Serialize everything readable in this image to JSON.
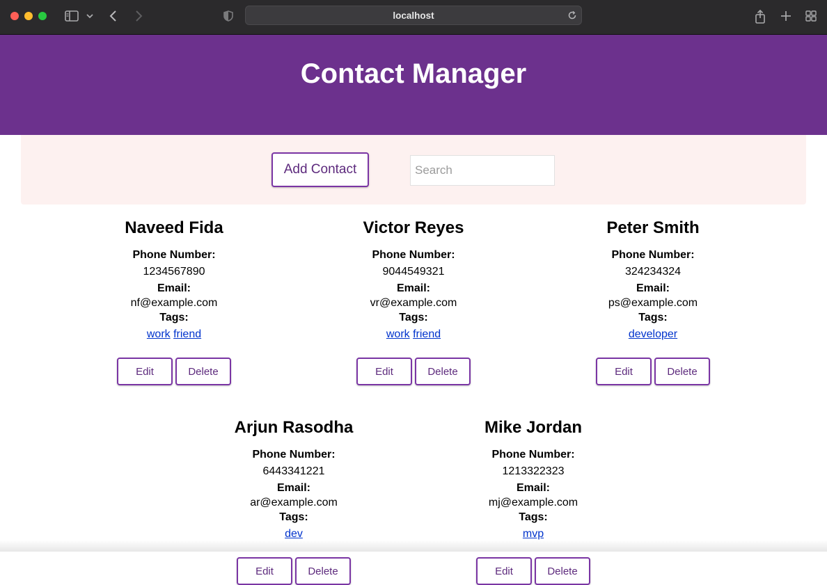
{
  "browser": {
    "url": "localhost",
    "icons": [
      "sidebar-icon",
      "chevron-down-icon",
      "back-icon",
      "forward-icon",
      "shield-icon",
      "reload-icon",
      "share-icon",
      "new-tab-icon",
      "tab-overview-icon"
    ]
  },
  "header": {
    "title": "Contact Manager"
  },
  "toolbar": {
    "add_label": "Add Contact",
    "search_placeholder": "Search"
  },
  "labels": {
    "phone": "Phone Number:",
    "email": "Email:",
    "tags": "Tags:",
    "edit": "Edit",
    "delete": "Delete"
  },
  "contacts": [
    {
      "name": "Naveed Fida",
      "phone": "1234567890",
      "email": "nf@example.com",
      "tags": [
        "work",
        "friend"
      ]
    },
    {
      "name": "Victor Reyes",
      "phone": "9044549321",
      "email": "vr@example.com",
      "tags": [
        "work",
        "friend"
      ]
    },
    {
      "name": "Peter Smith",
      "phone": "324234324",
      "email": "ps@example.com",
      "tags": [
        "developer"
      ]
    },
    {
      "name": "Arjun Rasodha",
      "phone": "6443341221",
      "email": "ar@example.com",
      "tags": [
        "dev"
      ]
    },
    {
      "name": "Mike Jordan",
      "phone": "1213322323",
      "email": "mj@example.com",
      "tags": [
        "mvp"
      ]
    }
  ],
  "colors": {
    "header": "#6c318d",
    "toolbar": "#fdf1f0",
    "accent": "#7a35a4",
    "link": "#0033cc"
  }
}
